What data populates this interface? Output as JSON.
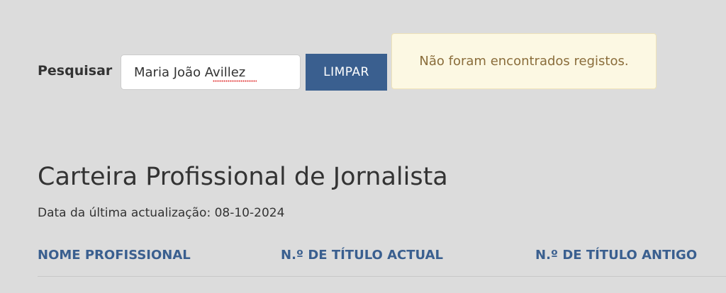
{
  "search": {
    "label": "Pesquisar",
    "value": "Maria João Avillez",
    "clear_label": "LIMPAR"
  },
  "alert": {
    "message": "Não foram encontrados registos."
  },
  "page": {
    "title": "Carteira Profissional de Jornalista",
    "update_label": "Data da última actualização:",
    "update_date": "08-10-2024"
  },
  "table": {
    "columns": [
      "NOME PROFISSIONAL",
      "N.º DE TÍTULO ACTUAL",
      "N.º DE TÍTULO ANTIGO"
    ]
  },
  "colors": {
    "background": "#dcdcdc",
    "accent": "#3a5f8f",
    "alert_background": "#fcf8e3",
    "alert_text": "#8a6d3b"
  }
}
